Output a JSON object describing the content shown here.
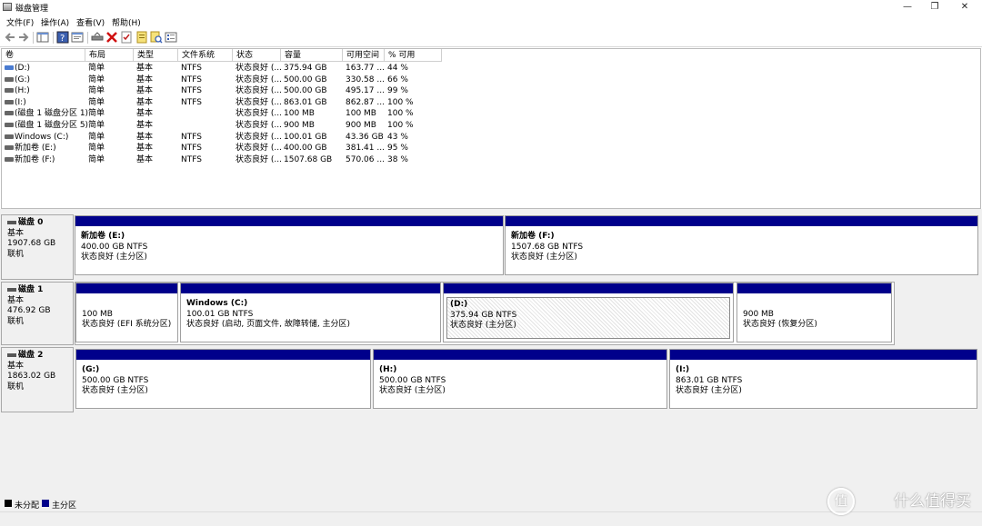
{
  "window": {
    "title": "磁盘管理"
  },
  "menu": [
    "文件(F)",
    "操作(A)",
    "查看(V)",
    "帮助(H)"
  ],
  "toolbar_icons": [
    "back-arrow-icon",
    "forward-arrow-icon",
    "console-tree-icon",
    "help-icon",
    "properties-icon",
    "connect-icon",
    "delete-icon",
    "check-icon",
    "rescan-icon",
    "search-icon",
    "list-icon"
  ],
  "columns": [
    "卷",
    "布局",
    "类型",
    "文件系统",
    "状态",
    "容量",
    "可用空间",
    "% 可用"
  ],
  "volumes": [
    {
      "name": "(D:)",
      "layout": "简单",
      "type": "基本",
      "fs": "NTFS",
      "status": "状态良好 (...",
      "capacity": "375.94 GB",
      "free": "163.77 ...",
      "pct": "44 %"
    },
    {
      "name": "(G:)",
      "layout": "简单",
      "type": "基本",
      "fs": "NTFS",
      "status": "状态良好 (...",
      "capacity": "500.00 GB",
      "free": "330.58 ...",
      "pct": "66 %"
    },
    {
      "name": "(H:)",
      "layout": "简单",
      "type": "基本",
      "fs": "NTFS",
      "status": "状态良好 (...",
      "capacity": "500.00 GB",
      "free": "495.17 ...",
      "pct": "99 %"
    },
    {
      "name": "(I:)",
      "layout": "简单",
      "type": "基本",
      "fs": "NTFS",
      "status": "状态良好 (...",
      "capacity": "863.01 GB",
      "free": "862.87 ...",
      "pct": "100 %"
    },
    {
      "name": "(磁盘 1 磁盘分区 1)",
      "layout": "简单",
      "type": "基本",
      "fs": "",
      "status": "状态良好 (...",
      "capacity": "100 MB",
      "free": "100 MB",
      "pct": "100 %"
    },
    {
      "name": "(磁盘 1 磁盘分区 5)",
      "layout": "简单",
      "type": "基本",
      "fs": "",
      "status": "状态良好 (...",
      "capacity": "900 MB",
      "free": "900 MB",
      "pct": "100 %"
    },
    {
      "name": "Windows (C:)",
      "layout": "简单",
      "type": "基本",
      "fs": "NTFS",
      "status": "状态良好 (...",
      "capacity": "100.01 GB",
      "free": "43.36 GB",
      "pct": "43 %"
    },
    {
      "name": "新加卷 (E:)",
      "layout": "简单",
      "type": "基本",
      "fs": "NTFS",
      "status": "状态良好 (...",
      "capacity": "400.00 GB",
      "free": "381.41 ...",
      "pct": "95 %"
    },
    {
      "name": "新加卷 (F:)",
      "layout": "简单",
      "type": "基本",
      "fs": "NTFS",
      "status": "状态良好 (...",
      "capacity": "1507.68 GB",
      "free": "570.06 ...",
      "pct": "38 %"
    }
  ],
  "disks": [
    {
      "name": "磁盘 0",
      "type": "基本",
      "size": "1907.68 GB",
      "state": "联机",
      "partitions": [
        {
          "name": "新加卷 (E:)",
          "size": "400.00 GB NTFS",
          "status": "状态良好 (主分区)"
        },
        {
          "name": "新加卷 (F:)",
          "size": "1507.68 GB NTFS",
          "status": "状态良好 (主分区)"
        }
      ]
    },
    {
      "name": "磁盘 1",
      "type": "基本",
      "size": "476.92 GB",
      "state": "联机",
      "partitions": [
        {
          "name": "",
          "size": "100 MB",
          "status": "状态良好 (EFI 系统分区)"
        },
        {
          "name": "Windows (C:)",
          "size": "100.01 GB NTFS",
          "status": "状态良好 (启动, 页面文件, 故障转储, 主分区)"
        },
        {
          "name": "(D:)",
          "size": "375.94 GB NTFS",
          "status": "状态良好 (主分区)"
        },
        {
          "name": "",
          "size": "900 MB",
          "status": "状态良好 (恢复分区)"
        }
      ]
    },
    {
      "name": "磁盘 2",
      "type": "基本",
      "size": "1863.02 GB",
      "state": "联机",
      "partitions": [
        {
          "name": "(G:)",
          "size": "500.00 GB NTFS",
          "status": "状态良好 (主分区)"
        },
        {
          "name": "(H:)",
          "size": "500.00 GB NTFS",
          "status": "状态良好 (主分区)"
        },
        {
          "name": "(I:)",
          "size": "863.01 GB NTFS",
          "status": "状态良好 (主分区)"
        }
      ]
    }
  ],
  "legend": [
    {
      "label": "未分配",
      "color": "#000000"
    },
    {
      "label": "主分区",
      "color": "#00008b"
    }
  ],
  "watermark": {
    "symbol": "值",
    "text": "什么值得买"
  }
}
